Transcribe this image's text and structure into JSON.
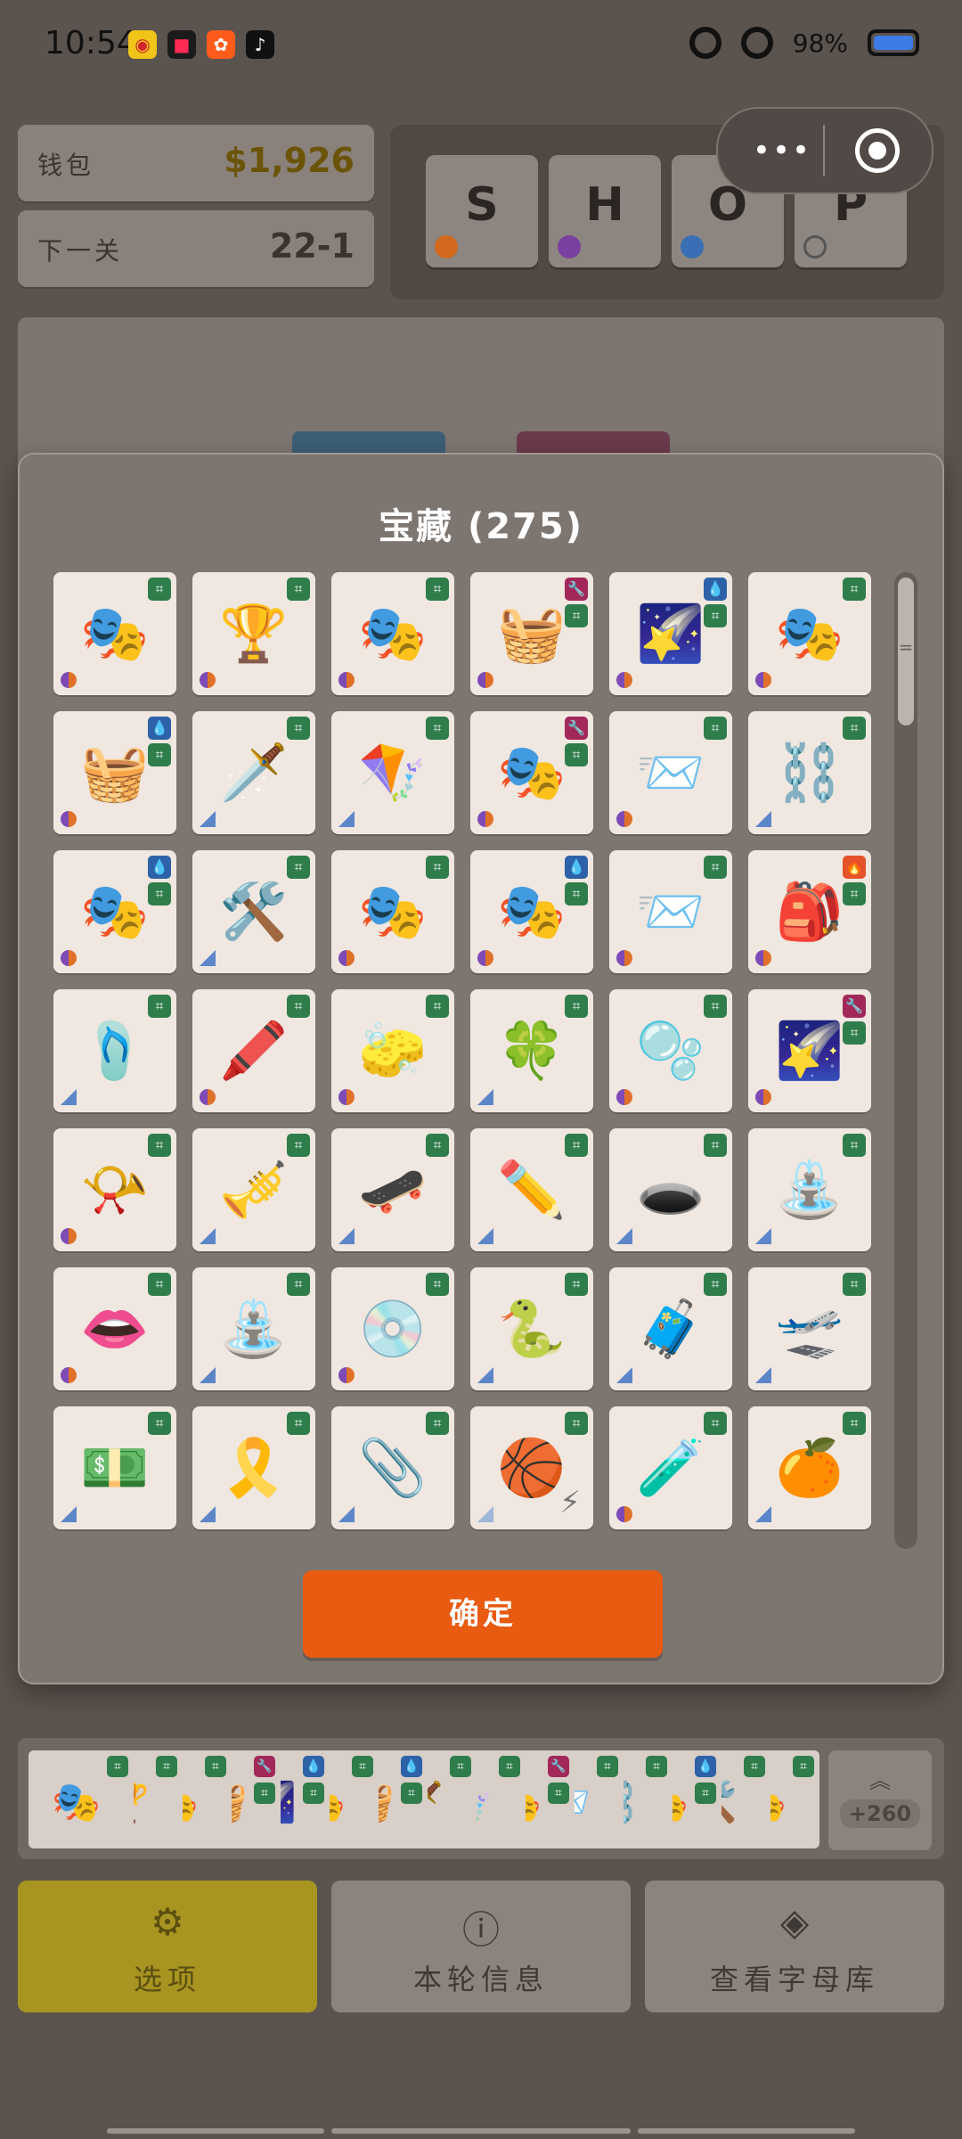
{
  "status_bar": {
    "time": "10:54",
    "battery": "98%",
    "notification_icons": [
      "weibo-icon",
      "video-icon",
      "kuaishou-icon",
      "tiktok-icon"
    ]
  },
  "wallet": {
    "label": "钱包",
    "value": "$1,926"
  },
  "next_level": {
    "label": "下一关",
    "value": "22-1"
  },
  "shop": {
    "letters": [
      {
        "char": "S",
        "dot_color": "#d2691e"
      },
      {
        "char": "H",
        "dot_color": "#7a3fa0"
      },
      {
        "char": "O",
        "dot_color": "#3b6fb5"
      },
      {
        "char": "P",
        "dot_color": "outline"
      }
    ]
  },
  "capsule": {
    "more_label": "•••"
  },
  "modal": {
    "title": "宝藏",
    "count": "(275)",
    "confirm_label": "确定",
    "items": [
      {
        "emoji": "🎭",
        "badges": [
          "g"
        ],
        "corner": "rb"
      },
      {
        "emoji": "🏆",
        "badges": [
          "g"
        ],
        "corner": "rb"
      },
      {
        "emoji": "🎭",
        "badges": [
          "g"
        ],
        "corner": "rb"
      },
      {
        "emoji": "🧺",
        "badges": [
          "m",
          "g"
        ],
        "corner": "rb"
      },
      {
        "emoji": "🌠",
        "badges": [
          "b",
          "g"
        ],
        "corner": "rb"
      },
      {
        "emoji": "🎭",
        "badges": [
          "g"
        ],
        "corner": "rb"
      },
      {
        "emoji": "🧺",
        "badges": [
          "b",
          "g"
        ],
        "corner": "rb"
      },
      {
        "emoji": "🗡️",
        "badges": [
          "g"
        ],
        "corner": "tri"
      },
      {
        "emoji": "🪁",
        "badges": [
          "g"
        ],
        "corner": "tri"
      },
      {
        "emoji": "🎭",
        "badges": [
          "m",
          "g"
        ],
        "corner": "rb"
      },
      {
        "emoji": "📨",
        "badges": [
          "g"
        ],
        "corner": "rb"
      },
      {
        "emoji": "⛓️",
        "badges": [
          "g"
        ],
        "corner": "tri"
      },
      {
        "emoji": "🎭",
        "badges": [
          "b",
          "g"
        ],
        "corner": "rb"
      },
      {
        "emoji": "🛠️",
        "badges": [
          "g"
        ],
        "corner": "tri"
      },
      {
        "emoji": "🎭",
        "badges": [
          "g"
        ],
        "corner": "rb"
      },
      {
        "emoji": "🎭",
        "badges": [
          "b",
          "g"
        ],
        "corner": "rb"
      },
      {
        "emoji": "📨",
        "badges": [
          "g"
        ],
        "corner": "rb"
      },
      {
        "emoji": "🎒",
        "badges": [
          "o",
          "g"
        ],
        "corner": "rb"
      },
      {
        "emoji": "🩴",
        "badges": [
          "g"
        ],
        "corner": "tri"
      },
      {
        "emoji": "🖍️",
        "badges": [
          "g"
        ],
        "corner": "rb"
      },
      {
        "emoji": "🧽",
        "badges": [
          "g"
        ],
        "corner": "rb"
      },
      {
        "emoji": "🍀",
        "badges": [
          "g"
        ],
        "corner": "tri"
      },
      {
        "emoji": "🫧",
        "badges": [
          "g"
        ],
        "corner": "rb"
      },
      {
        "emoji": "🌠",
        "badges": [
          "m",
          "g"
        ],
        "corner": "rb"
      },
      {
        "emoji": "📯",
        "badges": [
          "g"
        ],
        "corner": "rb"
      },
      {
        "emoji": "🎺",
        "badges": [
          "g"
        ],
        "corner": "tri"
      },
      {
        "emoji": "🛹",
        "badges": [
          "g"
        ],
        "corner": "tri"
      },
      {
        "emoji": "✏️",
        "badges": [
          "g"
        ],
        "corner": "tri"
      },
      {
        "emoji": "🕳️",
        "badges": [
          "g"
        ],
        "corner": "tri"
      },
      {
        "emoji": "⛲",
        "badges": [
          "g"
        ],
        "corner": "tri"
      },
      {
        "emoji": "👄",
        "badges": [
          "g"
        ],
        "corner": "rb"
      },
      {
        "emoji": "⛲",
        "badges": [
          "g"
        ],
        "corner": "tri"
      },
      {
        "emoji": "💿",
        "badges": [
          "g"
        ],
        "corner": "rb"
      },
      {
        "emoji": "🐍",
        "badges": [
          "g"
        ],
        "corner": "tri"
      },
      {
        "emoji": "🧳",
        "badges": [
          "g"
        ],
        "corner": "tri"
      },
      {
        "emoji": "🛫",
        "badges": [
          "g"
        ],
        "corner": "tri"
      },
      {
        "emoji": "💵",
        "badges": [
          "g"
        ],
        "corner": "tri"
      },
      {
        "emoji": "🎗️",
        "badges": [
          "g"
        ],
        "corner": "tri"
      },
      {
        "emoji": "📎",
        "badges": [
          "g"
        ],
        "corner": "tri"
      },
      {
        "emoji": "🏀",
        "badges": [
          "g"
        ],
        "corner": "tri2",
        "bolt": true
      },
      {
        "emoji": "🧪",
        "badges": [
          "g"
        ],
        "corner": "rb"
      },
      {
        "emoji": "🍊",
        "badges": [
          "g"
        ],
        "corner": "tri"
      }
    ]
  },
  "collection_strip": {
    "items": [
      {
        "emoji": "🎭",
        "badges": [
          "g"
        ]
      },
      {
        "emoji": "🏆",
        "badges": [
          "g"
        ]
      },
      {
        "emoji": "🎭",
        "badges": [
          "g"
        ]
      },
      {
        "emoji": "🧺",
        "badges": [
          "m",
          "g"
        ]
      },
      {
        "emoji": "🌠",
        "badges": [
          "b",
          "g"
        ]
      },
      {
        "emoji": "🎭",
        "badges": [
          "g"
        ]
      },
      {
        "emoji": "🧺",
        "badges": [
          "b",
          "g"
        ]
      },
      {
        "emoji": "🗡️",
        "badges": [
          "g"
        ]
      },
      {
        "emoji": "🪁",
        "badges": [
          "g"
        ]
      },
      {
        "emoji": "🎭",
        "badges": [
          "m",
          "g"
        ]
      },
      {
        "emoji": "📨",
        "badges": [
          "g"
        ]
      },
      {
        "emoji": "⛓️",
        "badges": [
          "g"
        ]
      },
      {
        "emoji": "🎭",
        "badges": [
          "b",
          "g"
        ]
      },
      {
        "emoji": "🛠️",
        "badges": [
          "g"
        ]
      },
      {
        "emoji": "🎭",
        "badges": [
          "g"
        ]
      }
    ],
    "more_count": "+260"
  },
  "buttons": [
    {
      "label": "选项",
      "icon": "gear-icon"
    },
    {
      "label": "本轮信息",
      "icon": "info-icon"
    },
    {
      "label": "查看字母库",
      "icon": "layers-icon"
    }
  ]
}
